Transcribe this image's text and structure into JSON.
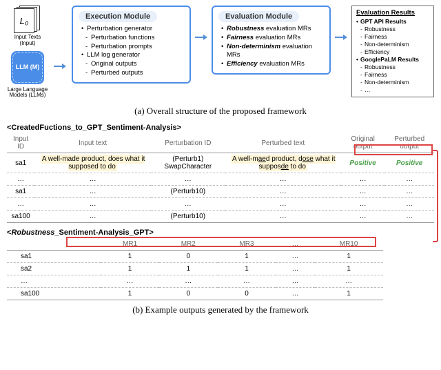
{
  "top": {
    "input_symbol": "L₀",
    "input_label": "Input Texts (Input)",
    "llm_text": "LLM (M)",
    "llm_label": "Large Language Models (LLMs)",
    "exec": {
      "title": "Execution Module",
      "items": [
        {
          "text": "Perturbation generator",
          "type": "bullet"
        },
        {
          "text": "Perturbation functions",
          "type": "sub"
        },
        {
          "text": "Perturbation prompts",
          "type": "sub"
        },
        {
          "text": "LLM log generator",
          "type": "bullet"
        },
        {
          "text": "Original outputs",
          "type": "sub"
        },
        {
          "text": "Perturbed outputs",
          "type": "sub"
        }
      ]
    },
    "eval": {
      "title": "Evaluation Module",
      "items": [
        {
          "prefix": "Robustness",
          "suffix": " evaluation MRs",
          "type": "bullet",
          "em": true
        },
        {
          "prefix": "Fairness",
          "suffix": " evaluation MRs",
          "type": "bullet",
          "em": true
        },
        {
          "prefix": "Non-determinism",
          "suffix": " evaluation MRs",
          "type": "bullet",
          "em": true
        },
        {
          "prefix": "Efficiency",
          "suffix": " evaluation MRs",
          "type": "bullet",
          "em": true
        }
      ]
    },
    "results": {
      "title": "Evaluation Results",
      "groups": [
        {
          "head": "GPT API Results",
          "subs": [
            "Robustness",
            "Fairness",
            "Non-determinism",
            "Efficiency"
          ]
        },
        {
          "head": "GooglePaLM Results",
          "subs": [
            "Robustness",
            "Fairness",
            "Non-determinism",
            "…"
          ]
        }
      ]
    }
  },
  "caption_a": "(a) Overall structure of the proposed framework",
  "tableA": {
    "title": "<CreatedFuctions_to_GPT_Sentiment-Analysis>",
    "headers": [
      "Input ID",
      "Input text",
      "Perturbation ID",
      "Perturbed text",
      "Original output",
      "Perturbed output"
    ],
    "row1": {
      "id": "sa1",
      "input_text": "A well-made product, does what it supposed to do",
      "perturb_id": "(Perturb1) SwapCharacter",
      "perturbed_text_parts": [
        "A well-m",
        "ae",
        "d product, d",
        "ose",
        " what it suppos",
        "de",
        " to do"
      ],
      "orig": "Positive",
      "pert": "Positive"
    },
    "rows_rest": [
      {
        "id": "…",
        "t": "…",
        "p": "…",
        "pt": "…",
        "o": "…",
        "po": "…"
      },
      {
        "id": "sa1",
        "t": "…",
        "p": "(Perturb10)",
        "pt": "…",
        "o": "…",
        "po": "…"
      },
      {
        "id": "…",
        "t": "…",
        "p": "…",
        "pt": "…",
        "o": "…",
        "po": "…"
      },
      {
        "id": "sa100",
        "t": "…",
        "p": "(Perturb10)",
        "pt": "…",
        "o": "…",
        "po": "…"
      }
    ]
  },
  "tableB": {
    "title": "<Robustness_Sentiment-Analysis_GPT>",
    "title_em": "Robustness",
    "title_rest": "_Sentiment-Analysis_GPT>",
    "headers": [
      "",
      "MR1",
      "MR2",
      "MR3",
      "…",
      "MR10"
    ],
    "rows": [
      {
        "id": "sa1",
        "v": [
          "1",
          "0",
          "1",
          "…",
          "1"
        ]
      },
      {
        "id": "sa2",
        "v": [
          "1",
          "1",
          "1",
          "…",
          "1"
        ]
      },
      {
        "id": "…",
        "v": [
          "…",
          "…",
          "…",
          "…",
          "…"
        ]
      },
      {
        "id": "sa100",
        "v": [
          "1",
          "0",
          "0",
          "…",
          "1"
        ]
      }
    ]
  },
  "caption_b": "(b) Example outputs generated by the framework",
  "chart_data": {
    "type": "table",
    "tables": [
      {
        "name": "CreatedFuctions_to_GPT_Sentiment-Analysis",
        "columns": [
          "Input ID",
          "Input text",
          "Perturbation ID",
          "Perturbed text",
          "Original output",
          "Perturbed output"
        ],
        "rows": [
          [
            "sa1",
            "A well-made product, does what it supposed to do",
            "(Perturb1) SwapCharacter",
            "A well-maed product, dose what it supposde to do",
            "Positive",
            "Positive"
          ],
          [
            "…",
            "…",
            "…",
            "…",
            "…",
            "…"
          ],
          [
            "sa1",
            "…",
            "(Perturb10)",
            "…",
            "…",
            "…"
          ],
          [
            "…",
            "…",
            "…",
            "…",
            "…",
            "…"
          ],
          [
            "sa100",
            "…",
            "(Perturb10)",
            "…",
            "…",
            "…"
          ]
        ]
      },
      {
        "name": "Robustness_Sentiment-Analysis_GPT",
        "columns": [
          "",
          "MR1",
          "MR2",
          "MR3",
          "…",
          "MR10"
        ],
        "rows": [
          [
            "sa1",
            1,
            0,
            1,
            "…",
            1
          ],
          [
            "sa2",
            1,
            1,
            1,
            "…",
            1
          ],
          [
            "…",
            "…",
            "…",
            "…",
            "…",
            "…"
          ],
          [
            "sa100",
            1,
            0,
            0,
            "…",
            1
          ]
        ]
      }
    ]
  }
}
